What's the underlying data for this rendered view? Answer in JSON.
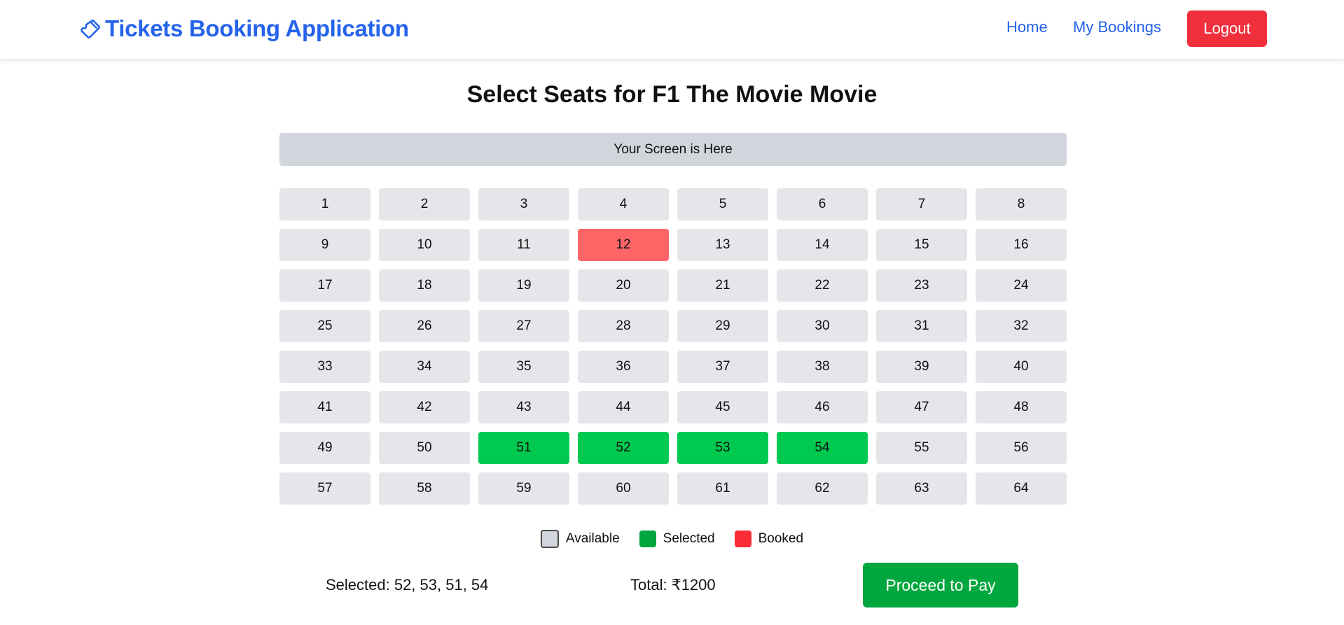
{
  "nav": {
    "brand": "Tickets Booking Application",
    "brand_icon": "ticket-icon",
    "home": "Home",
    "my_bookings": "My Bookings",
    "logout": "Logout"
  },
  "title": "Select Seats for F1 The Movie Movie",
  "screen_label": "Your Screen is Here",
  "seats": [
    {
      "label": "1",
      "status": "available"
    },
    {
      "label": "2",
      "status": "available"
    },
    {
      "label": "3",
      "status": "available"
    },
    {
      "label": "4",
      "status": "available"
    },
    {
      "label": "5",
      "status": "available"
    },
    {
      "label": "6",
      "status": "available"
    },
    {
      "label": "7",
      "status": "available"
    },
    {
      "label": "8",
      "status": "available"
    },
    {
      "label": "9",
      "status": "available"
    },
    {
      "label": "10",
      "status": "available"
    },
    {
      "label": "11",
      "status": "available"
    },
    {
      "label": "12",
      "status": "booked"
    },
    {
      "label": "13",
      "status": "available"
    },
    {
      "label": "14",
      "status": "available"
    },
    {
      "label": "15",
      "status": "available"
    },
    {
      "label": "16",
      "status": "available"
    },
    {
      "label": "17",
      "status": "available"
    },
    {
      "label": "18",
      "status": "available"
    },
    {
      "label": "19",
      "status": "available"
    },
    {
      "label": "20",
      "status": "available"
    },
    {
      "label": "21",
      "status": "available"
    },
    {
      "label": "22",
      "status": "available"
    },
    {
      "label": "23",
      "status": "available"
    },
    {
      "label": "24",
      "status": "available"
    },
    {
      "label": "25",
      "status": "available"
    },
    {
      "label": "26",
      "status": "available"
    },
    {
      "label": "27",
      "status": "available"
    },
    {
      "label": "28",
      "status": "available"
    },
    {
      "label": "29",
      "status": "available"
    },
    {
      "label": "30",
      "status": "available"
    },
    {
      "label": "31",
      "status": "available"
    },
    {
      "label": "32",
      "status": "available"
    },
    {
      "label": "33",
      "status": "available"
    },
    {
      "label": "34",
      "status": "available"
    },
    {
      "label": "35",
      "status": "available"
    },
    {
      "label": "36",
      "status": "available"
    },
    {
      "label": "37",
      "status": "available"
    },
    {
      "label": "38",
      "status": "available"
    },
    {
      "label": "39",
      "status": "available"
    },
    {
      "label": "40",
      "status": "available"
    },
    {
      "label": "41",
      "status": "available"
    },
    {
      "label": "42",
      "status": "available"
    },
    {
      "label": "43",
      "status": "available"
    },
    {
      "label": "44",
      "status": "available"
    },
    {
      "label": "45",
      "status": "available"
    },
    {
      "label": "46",
      "status": "available"
    },
    {
      "label": "47",
      "status": "available"
    },
    {
      "label": "48",
      "status": "available"
    },
    {
      "label": "49",
      "status": "available"
    },
    {
      "label": "50",
      "status": "available"
    },
    {
      "label": "51",
      "status": "selected"
    },
    {
      "label": "52",
      "status": "selected"
    },
    {
      "label": "53",
      "status": "selected"
    },
    {
      "label": "54",
      "status": "selected"
    },
    {
      "label": "55",
      "status": "available"
    },
    {
      "label": "56",
      "status": "available"
    },
    {
      "label": "57",
      "status": "available"
    },
    {
      "label": "58",
      "status": "available"
    },
    {
      "label": "59",
      "status": "available"
    },
    {
      "label": "60",
      "status": "available"
    },
    {
      "label": "61",
      "status": "available"
    },
    {
      "label": "62",
      "status": "available"
    },
    {
      "label": "63",
      "status": "available"
    },
    {
      "label": "64",
      "status": "available"
    }
  ],
  "legend": {
    "available": "Available",
    "selected": "Selected",
    "booked": "Booked"
  },
  "summary": {
    "selected": "Selected: 52, 53, 51, 54",
    "total": "Total: ₹1200",
    "proceed": "Proceed to Pay"
  },
  "colors": {
    "brand": "#2563eb",
    "logout": "#ef2f3c",
    "seat_available": "#e4e6ea",
    "seat_selected": "#00c950",
    "seat_booked": "#ff6467",
    "proceed": "#00a63e"
  }
}
